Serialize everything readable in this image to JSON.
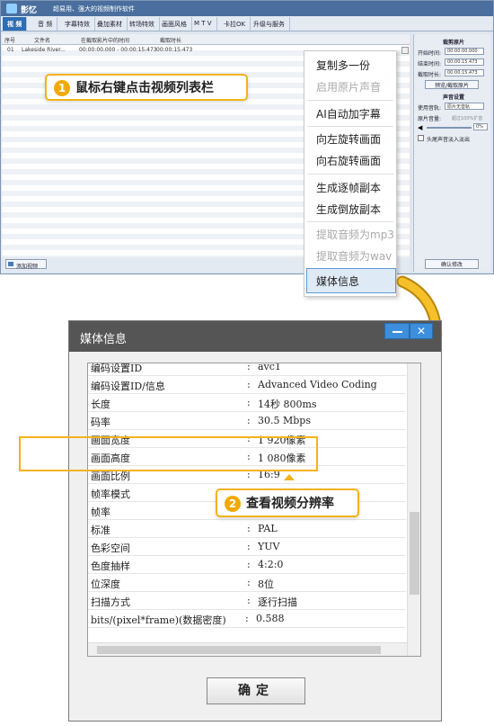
{
  "app": {
    "name": "影忆",
    "subtitle": "超易用、强大的视频制作软件"
  },
  "menu": [
    "视 频",
    "音 频",
    "字幕特效",
    "叠加素材",
    "转场特效",
    "画面风格",
    "M T V",
    "卡拉OK",
    "升级与服务"
  ],
  "list": {
    "headers": [
      "序号",
      "文件名",
      "在截取影片中的时间",
      "截取时长"
    ],
    "row": {
      "index": "01",
      "filename": "Lakeside River...",
      "time": "00:00:00.000 - 00:00:15.473",
      "duration": "00:00:15.473"
    },
    "add_button": "添加视频"
  },
  "right_panel": {
    "section1": "裁剪原片",
    "start_label": "开始时间:",
    "start_value": "00:00:00.000",
    "end_label": "结束时间:",
    "end_value": "00:00:15.473",
    "dur_label": "截取时长:",
    "dur_value": "00:00:15.473",
    "preview_button": "预览/截取原片",
    "section2": "声音设置",
    "use_label": "使用音轨:",
    "use_value": "原片无音轨",
    "vol_label": "原片音量:",
    "vol_hint": "超过100%扩音",
    "vol_value": "0%",
    "fade_label": "头尾声音淡入淡出",
    "confirm_button": "确认修改"
  },
  "context_menu": {
    "items": [
      {
        "label": "复制多一份",
        "disabled": false
      },
      {
        "label": "启用原片声音",
        "disabled": true
      },
      {
        "label": "AI自动加字幕",
        "disabled": false
      },
      {
        "label": "向左旋转画面",
        "disabled": false
      },
      {
        "label": "向右旋转画面",
        "disabled": false
      },
      {
        "label": "生成逐帧副本",
        "disabled": false
      },
      {
        "label": "生成倒放副本",
        "disabled": false
      },
      {
        "label": "提取音频为mp3",
        "disabled": true
      },
      {
        "label": "提取音频为wav",
        "disabled": true
      },
      {
        "label": "媒体信息",
        "disabled": false
      }
    ]
  },
  "callouts": {
    "step1_num": "1",
    "step1": "鼠标右键点击视频列表栏",
    "step2_num": "2",
    "step2": "查看视频分辨率"
  },
  "dialog": {
    "title": "媒体信息",
    "close": "✕",
    "ok": "确定",
    "colon": ":",
    "rows": [
      {
        "k": "编码设置ID",
        "v": "avc1"
      },
      {
        "k": "编码设置ID/信息",
        "v": "Advanced Video Coding"
      },
      {
        "k": "长度",
        "v": "14秒 800ms"
      },
      {
        "k": "码率",
        "v": "30.5 Mbps"
      },
      {
        "k": "画面宽度",
        "v": "1 920像素"
      },
      {
        "k": "画面高度",
        "v": "1 080像素"
      },
      {
        "k": "画面比例",
        "v": "16:9"
      },
      {
        "k": "帧率模式",
        "v": ""
      },
      {
        "k": "帧率",
        "v": ""
      },
      {
        "k": "标准",
        "v": "PAL"
      },
      {
        "k": "色彩空间",
        "v": "YUV"
      },
      {
        "k": "色度抽样",
        "v": "4:2:0"
      },
      {
        "k": "位深度",
        "v": "8位"
      },
      {
        "k": "扫描方式",
        "v": "逐行扫描"
      },
      {
        "k": "bits/(pixel*frame)(数据密度)",
        "v": "0.588"
      }
    ]
  },
  "colors": {
    "accent": "#f2b21a",
    "selected": "#2f6db3"
  }
}
